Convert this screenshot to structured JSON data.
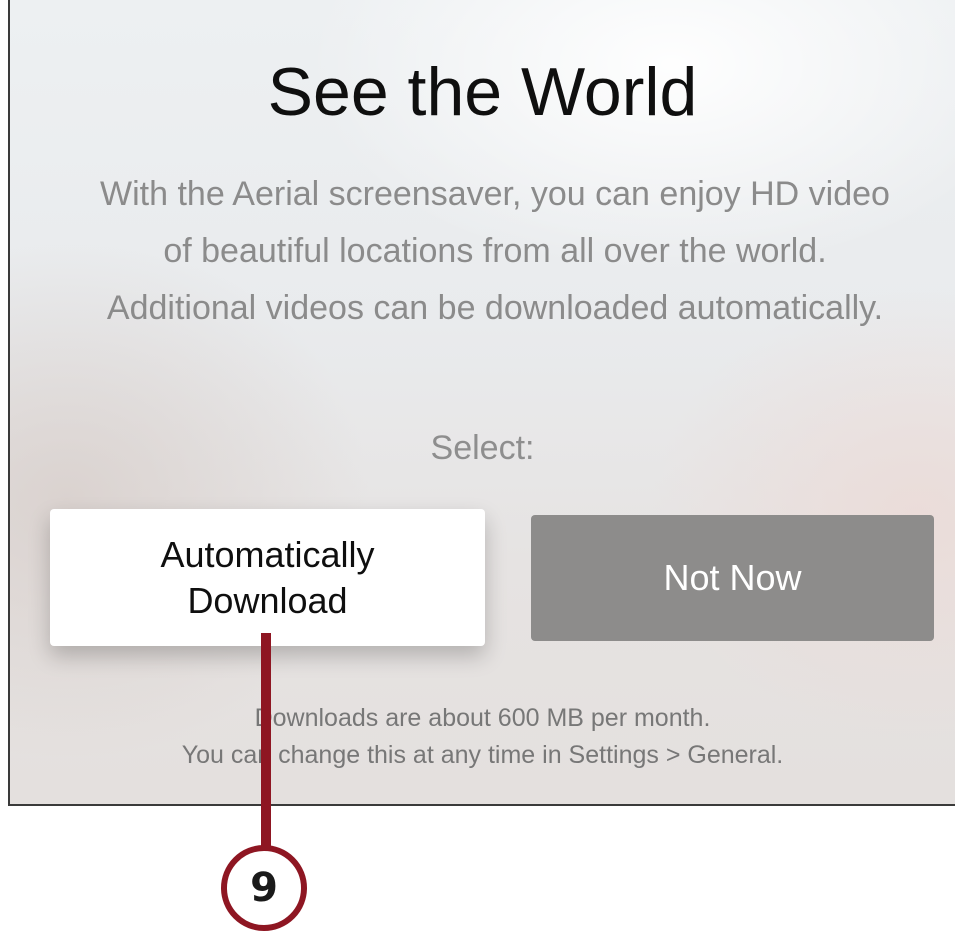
{
  "dialog": {
    "title": "See the World",
    "description": "With the Aerial screensaver, you can enjoy HD video of beautiful locations from all over the world. Additional videos can be downloaded automatically.",
    "select_label": "Select:",
    "primary_button_label": "Automatically Download",
    "secondary_button_label": "Not Now",
    "footnote_line1": "Downloads are about 600 MB per month.",
    "footnote_line2": "You can change this at any time in Settings > General."
  },
  "callout": {
    "number": "9",
    "color": "#8e1622"
  }
}
